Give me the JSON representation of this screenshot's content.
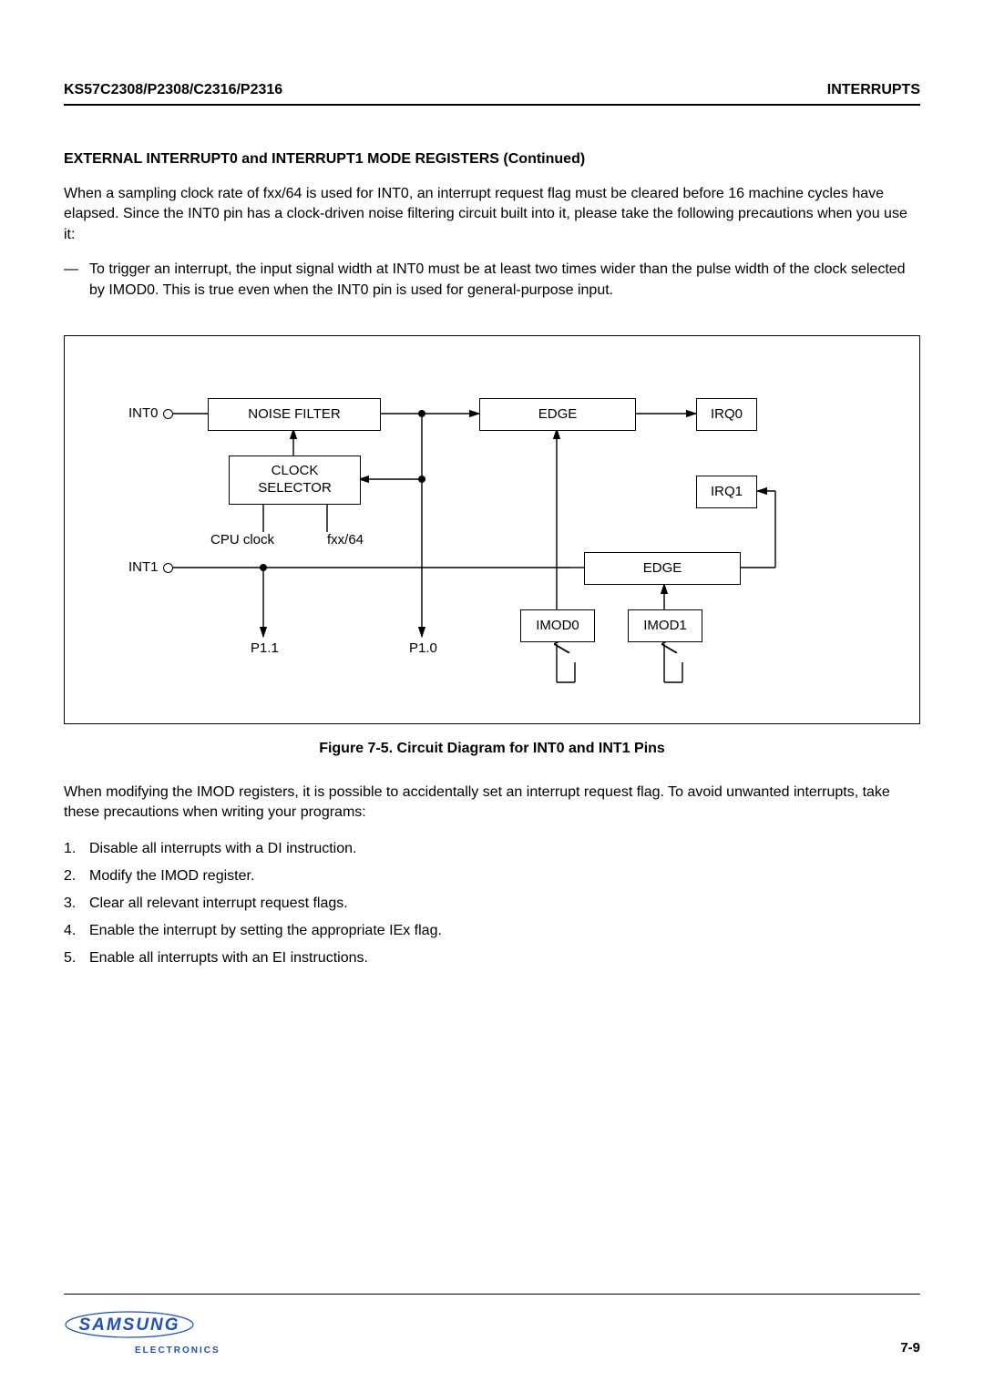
{
  "header": {
    "left": "KS57C2308/P2308/C2316/P2316",
    "right": "INTERRUPTS"
  },
  "section_title": "EXTERNAL INTERRUPT0 and INTERRUPT1 MODE REGISTERS (Continued)",
  "para1": "When a sampling clock rate of fxx/64 is used for INT0, an interrupt request flag must be cleared before 16 machine cycles have elapsed. Since the INT0 pin has a clock-driven noise filtering circuit built into it, please take the following precautions when you use it:",
  "bullet1": "To trigger an interrupt, the input signal width at INT0 must be at least two times wider than the pulse width of the clock selected by IMOD0. This is true even when the INT0 pin is used for general-purpose input.",
  "figure_caption": "Figure 7-5. Circuit Diagram for INT0 and INT1 Pins",
  "para2": "When modifying the IMOD registers, it is possible to accidentally set an interrupt request flag. To avoid unwanted interrupts, take these precautions when writing your programs:",
  "steps": [
    "Disable all interrupts with a DI instruction.",
    "Modify the IMOD register.",
    "Clear all relevant interrupt request flags.",
    "Enable the interrupt by setting the appropriate IEx flag.",
    "Enable all interrupts with an EI instructions."
  ],
  "diagram": {
    "int0": "INT0",
    "int1": "INT1",
    "noise_filter": "NOISE FILTER",
    "clock_selector": "CLOCK\nSELECTOR",
    "cpu_clock": "CPU clock",
    "fxx64": "fxx/64",
    "edge0": "EDGE",
    "edge1": "EDGE",
    "irq0": "IRQ0",
    "irq1": "IRQ1",
    "imod0": "IMOD0",
    "imod1": "IMOD1",
    "p11": "P1.1",
    "p10": "P1.0"
  },
  "footer": {
    "logo_top": "SAMSUNG",
    "logo_bottom": "ELECTRONICS",
    "page": "7-9"
  }
}
